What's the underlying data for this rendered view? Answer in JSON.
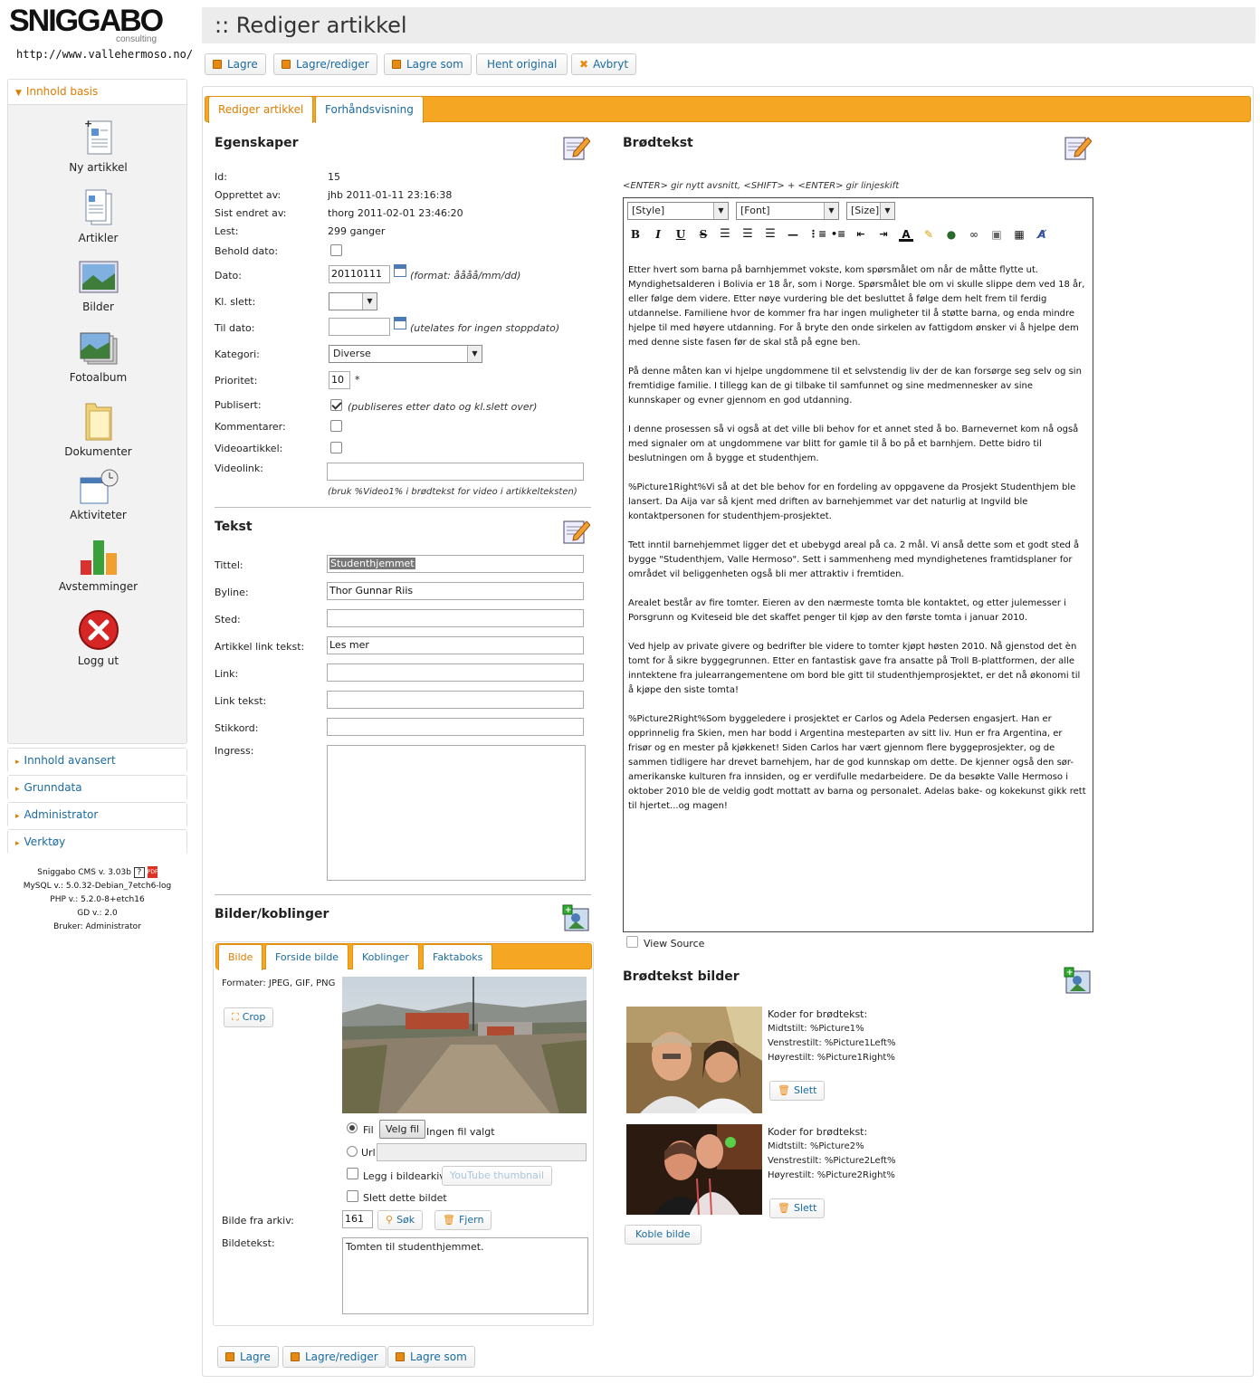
{
  "logo": {
    "name": "SNIGGABO",
    "sub": "consulting"
  },
  "site_url": "http://www.vallehermoso.no/",
  "sidebar": {
    "section_open": "Innhold basis",
    "items": [
      {
        "label": "Ny artikkel",
        "icon": "new-article-icon"
      },
      {
        "label": "Artikler",
        "icon": "articles-icon"
      },
      {
        "label": "Bilder",
        "icon": "images-icon"
      },
      {
        "label": "Fotoalbum",
        "icon": "photo-album-icon"
      },
      {
        "label": "Dokumenter",
        "icon": "folder-icon"
      },
      {
        "label": "Aktiviteter",
        "icon": "calendar-icon"
      },
      {
        "label": "Avstemminger",
        "icon": "poll-chart-icon"
      },
      {
        "label": "Logg ut",
        "icon": "logout-icon"
      }
    ],
    "sections_closed": [
      "Innhold avansert",
      "Grunndata",
      "Administrator",
      "Verktøy"
    ],
    "sysinfo": [
      "Sniggabo CMS v. 3.03b",
      "MySQL v.: 5.0.32-Debian_7etch6-log",
      "PHP v.: 5.2.0-8+etch16",
      "GD v.: 2.0",
      "Bruker: Administrator"
    ]
  },
  "page_title": ":: Rediger artikkel",
  "toolbar": {
    "lagre": "Lagre",
    "lagre_rediger": "Lagre/rediger",
    "lagre_som": "Lagre som",
    "hent_original": "Hent original",
    "avbryt": "Avbryt"
  },
  "tabs": {
    "edit": "Rediger artikkel",
    "preview": "Forhåndsvisning"
  },
  "egenskaper": {
    "heading": "Egenskaper",
    "id_label": "Id:",
    "id": "15",
    "created_label": "Opprettet av:",
    "created": "jhb 2011-01-11 23:16:38",
    "modified_label": "Sist endret av:",
    "modified": "thorg 2011-02-01 23:46:20",
    "read_label": "Lest:",
    "read": "299 ganger",
    "keepdate_label": "Behold dato:",
    "date_label": "Dato:",
    "date": "20110111",
    "date_hint": "(format: åååå/mm/dd)",
    "delete_label": "Kl. slett:",
    "todate_label": "Til dato:",
    "todate_hint": "(utelates for ingen stoppdato)",
    "category_label": "Kategori:",
    "category": "Diverse",
    "priority_label": "Prioritet:",
    "priority": "10",
    "priority_star": "*",
    "published_label": "Publisert:",
    "published_hint": "(publiseres etter dato og kl.slett over)",
    "comments_label": "Kommentarer:",
    "video_label": "Videoartikkel:",
    "videolink_label": "Videolink:",
    "videolink_hint": "(bruk %Video1% i brødtekst for video i artikkelteksten)"
  },
  "tekst": {
    "heading": "Tekst",
    "title_label": "Tittel:",
    "title": "Studenthjemmet",
    "byline_label": "Byline:",
    "byline": "Thor Gunnar Riis",
    "place_label": "Sted:",
    "linktext_label": "Artikkel link tekst:",
    "linktext": "Les mer",
    "link_label": "Link:",
    "linktext2_label": "Link tekst:",
    "keyword_label": "Stikkord:",
    "ingress_label": "Ingress:"
  },
  "bilder": {
    "heading": "Bilder/koblinger",
    "tabs": [
      "Bilde",
      "Forside bilde",
      "Koblinger",
      "Faktaboks"
    ],
    "formats": "Formater: JPEG, GIF, PNG",
    "crop": "Crop",
    "fil": "Fil",
    "velg_fil": "Velg fil",
    "ingen_fil": "Ingen fil valgt",
    "url": "Url",
    "legg_arkiv": "Legg i bildearkiv",
    "youtube": "YouTube thumbnail",
    "slett_bilde": "Slett dette bildet",
    "fra_arkiv_label": "Bilde fra arkiv:",
    "fra_arkiv": "161",
    "sok": "Søk",
    "fjern": "Fjern",
    "bildetekst_label": "Bildetekst:",
    "bildetekst": "Tomten til studenthjemmet."
  },
  "brodtekst": {
    "heading": "Brødtekst",
    "hint": "<ENTER> gir nytt avsnitt, <SHIFT> + <ENTER> gir linjeskift",
    "style": "[Style]",
    "font": "[Font]",
    "size": "[Size]",
    "paragraphs": [
      "Etter hvert som barna på barnhjemmet vokste, kom spørsmålet om når de måtte flytte ut.  Myndighetsalderen i Bolivia er 18 år, som i Norge. Spørsmålet ble om vi skulle slippe dem ved 18 år, eller følge dem videre. Etter nøye vurdering ble det besluttet å følge dem helt frem til ferdig utdannelse. Familiene hvor de kommer fra har ingen muligheter til å støtte barna, og enda mindre hjelpe til med høyere utdanning.  For å bryte den onde sirkelen av fattigdom ønsker vi å hjelpe dem med denne siste fasen før de skal stå på egne ben.",
      "På denne måten kan vi hjelpe ungdommene til et selvstendig liv der de kan forsørge seg selv og sin fremtidige familie. I tillegg kan de gi tilbake til samfunnet og sine medmennesker av sine kunnskaper og evner gjennom en god utdanning.",
      "I denne prosessen så vi også at det ville bli behov for et annet sted å bo. Barnevernet kom nå også med signaler om at ungdommene var blitt for gamle til å bo på et barnhjem. Dette bidro til beslutningen om å bygge et studenthjem.",
      "%Picture1Right%Vi så at det ble behov for en fordeling av oppgavene da Prosjekt Studenthjem ble lansert. Da Aija var så kjent med driften av barnehjemmet var det naturlig at Ingvild ble kontaktpersonen for studenthjem-prosjektet.",
      "Tett inntil barnehjemmet ligger det et ubebygd areal på ca. 2 mål. Vi anså dette som et godt sted å bygge \"Studenthjem, Valle Hermoso\". Sett i sammenheng med myndighetenes framtidsplaner for området vil beliggenheten også bli mer attraktiv i fremtiden.",
      "Arealet består av fire tomter. Eieren av den nærmeste tomta ble kontaktet, og etter julemesser i Porsgrunn og Kviteseid ble det skaffet penger til kjøp av den første tomta i januar 2010.",
      "Ved hjelp av private givere og bedrifter ble videre to tomter kjøpt høsten 2010. Nå gjenstod det èn tomt for å sikre byggegrunnen. Etter en fantastisk gave fra ansatte på Troll B-plattformen, der alle inntektene fra julearrangementene om bord ble gitt til studenthjemprosjektet, er det nå økonomi til å kjøpe den siste tomta!",
      " %Picture2Right%Som byggeledere i prosjektet er Carlos og Adela Pedersen engasjert. Han er opprinnelig fra Skien, men har bodd i Argentina mesteparten av sitt liv. Hun er fra Argentina, er frisør og en mester på kjøkkenet! Siden Carlos har vært gjennom flere byggeprosjekter, og de sammen tidligere har drevet barnehjem, har de god kunnskap om dette. De kjenner også den sør-amerikanske kulturen fra innsiden, og er verdifulle medarbeidere. De da besøkte Valle Hermoso i oktober 2010 ble de veldig godt mottatt av barna og personalet. Adelas bake- og kokekunst gikk rett til hjertet...og magen!"
    ],
    "view_source": "View Source"
  },
  "brodtekst_bilder": {
    "heading": "Brødtekst bilder",
    "images": [
      {
        "codes_label": "Koder for brødtekst:",
        "mid": "Midtstilt: %Picture1%",
        "left": "Venstrestilt: %Picture1Left%",
        "right": "Høyrestilt: %Picture1Right%",
        "delete": "Slett"
      },
      {
        "codes_label": "Koder for brødtekst:",
        "mid": "Midtstilt: %Picture2%",
        "left": "Venstrestilt: %Picture2Left%",
        "right": "Høyrestilt: %Picture2Right%",
        "delete": "Slett"
      }
    ],
    "link_image": "Koble bilde"
  },
  "colors": {
    "accent": "#f5a623",
    "link": "#1a6ba0",
    "orange_text": "#e07c00"
  }
}
